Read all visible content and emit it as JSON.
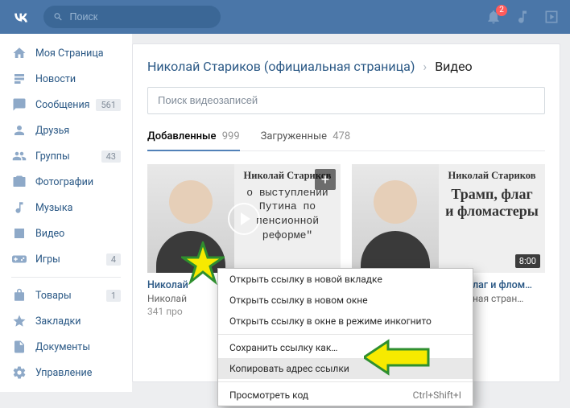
{
  "header": {
    "search_placeholder": "Поиск",
    "notification_count": "2"
  },
  "sidebar": {
    "items": [
      {
        "label": "Моя Страница",
        "icon": "home"
      },
      {
        "label": "Новости",
        "icon": "news"
      },
      {
        "label": "Сообщения",
        "icon": "messages",
        "badge": "561"
      },
      {
        "label": "Друзья",
        "icon": "friends"
      },
      {
        "label": "Группы",
        "icon": "groups",
        "badge": "43"
      },
      {
        "label": "Фотографии",
        "icon": "photos"
      },
      {
        "label": "Музыка",
        "icon": "music"
      },
      {
        "label": "Видео",
        "icon": "video"
      },
      {
        "label": "Игры",
        "icon": "games",
        "badge": "4"
      }
    ],
    "items2": [
      {
        "label": "Товары",
        "icon": "market",
        "badge": "1"
      },
      {
        "label": "Закладки",
        "icon": "bookmarks"
      },
      {
        "label": "Документы",
        "icon": "documents"
      },
      {
        "label": "Управление",
        "icon": "settings"
      }
    ]
  },
  "main": {
    "breadcrumb_page": "Николай Стариков (официальная страница)",
    "breadcrumb_current": "Видео",
    "video_search_placeholder": "Поиск видеозаписей",
    "tabs": [
      {
        "label": "Добавленные",
        "count": "999",
        "active": true
      },
      {
        "label": "Загруженные",
        "count": "478",
        "active": false
      }
    ],
    "videos": [
      {
        "thumb_title": "Николай Стариков",
        "thumb_desc": "о выступлении Путина по пенсионной реформе\"",
        "title": "Николай",
        "author": "Николай",
        "views": "341 про"
      },
      {
        "thumb_title": "Николай Стариков",
        "thumb_desc2": "Трамп, флаг и фломастеры",
        "duration": "8:00",
        "title": "лаг и флом…",
        "author": "ная стран…"
      }
    ]
  },
  "context_menu": {
    "items_a": [
      "Открыть ссылку в новой вкладке",
      "Открыть ссылку в новом окне",
      "Открыть ссылку в окне в режиме инкогнито"
    ],
    "items_b": [
      "Сохранить ссылку как…",
      "Копировать адрес ссылки"
    ],
    "items_c": [
      {
        "label": "Просмотреть код",
        "shortcut": "Ctrl+Shift+I"
      }
    ]
  }
}
